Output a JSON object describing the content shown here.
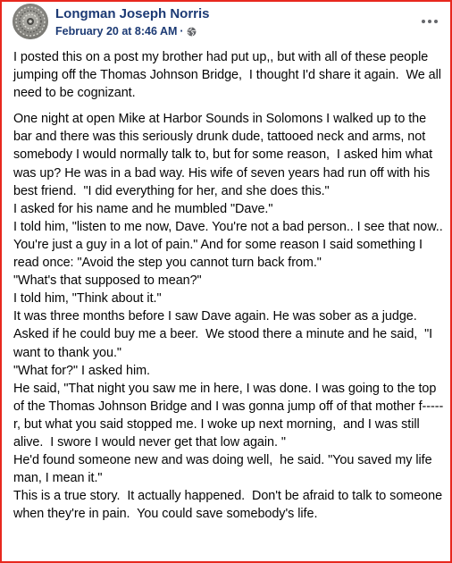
{
  "post": {
    "author": "Longman Joseph Norris",
    "timestamp": "February 20 at 8:46 AM",
    "separator": "·",
    "privacy_icon": "globe-icon",
    "menu_icon": "more-options-icon",
    "paragraphs": [
      "I posted this on a post my brother had put up,, but with all of these people jumping off the Thomas Johnson Bridge,  I thought I'd share it again.  We all need to be cognizant.",
      "One night at open Mike at Harbor Sounds in Solomons I walked up to the bar and there was this seriously drunk dude, tattooed neck and arms, not somebody I would normally talk to, but for some reason,  I asked him what was up? He was in a bad way. His wife of seven years had run off with his best friend.  \"I did everything for her, and she does this.\"",
      "I asked for his name and he mumbled \"Dave.\"",
      "I told him, \"listen to me now, Dave. You're not a bad person.. I see that now.. You're just a guy in a lot of pain.\" And for some reason I said something I read once: \"Avoid the step you cannot turn back from.\"",
      "\"What's that supposed to mean?\"",
      "I told him, \"Think about it.\"",
      "It was three months before I saw Dave again. He was sober as a judge. Asked if he could buy me a beer.  We stood there a minute and he said,  \"I want to thank you.\"",
      "\"What for?\" I asked him.",
      "He said, \"That night you saw me in here, I was done. I was going to the top of the Thomas Johnson Bridge and I was gonna jump off of that mother f-----r, but what you said stopped me. I woke up next morning,  and I was still alive.  I swore I would never get that low again. \"",
      "He'd found someone new and was doing well,  he said. \"You saved my life man, I mean it.\"",
      "This is a true story.  It actually happened.  Don't be afraid to talk to someone when they're in pain.  You could save somebody's life."
    ]
  },
  "colors": {
    "frame_border": "#e8281e",
    "author_text": "#1c3a74",
    "body_text": "#050505",
    "icon_gray": "#65676b"
  }
}
